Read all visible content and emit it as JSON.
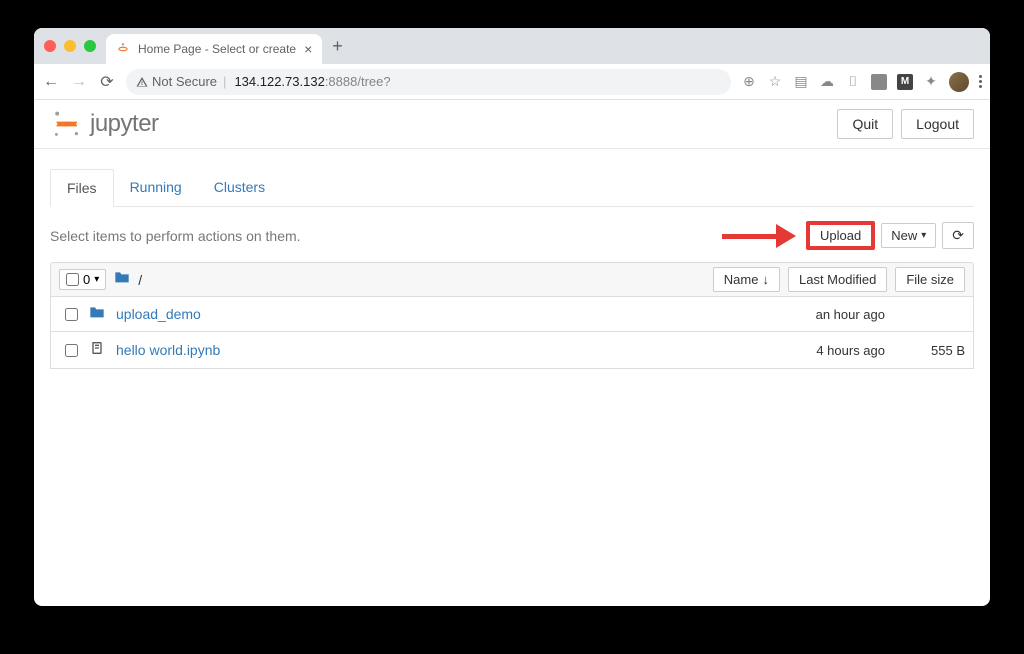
{
  "browser": {
    "tab_title": "Home Page - Select or create",
    "url_not_secure": "Not Secure",
    "url_host": "134.122.73.132",
    "url_rest": ":8888/tree?"
  },
  "header": {
    "brand": "jupyter",
    "quit": "Quit",
    "logout": "Logout"
  },
  "tabs": {
    "files": "Files",
    "running": "Running",
    "clusters": "Clusters"
  },
  "actions": {
    "hint": "Select items to perform actions on them.",
    "upload": "Upload",
    "new": "New"
  },
  "list": {
    "selected_count": "0",
    "path_sep": "/",
    "col_name": "Name",
    "col_modified": "Last Modified",
    "col_size": "File size",
    "rows": [
      {
        "type": "dir",
        "name": "upload_demo",
        "modified": "an hour ago",
        "size": ""
      },
      {
        "type": "nb",
        "name": "hello world.ipynb",
        "modified": "4 hours ago",
        "size": "555 B"
      }
    ]
  }
}
